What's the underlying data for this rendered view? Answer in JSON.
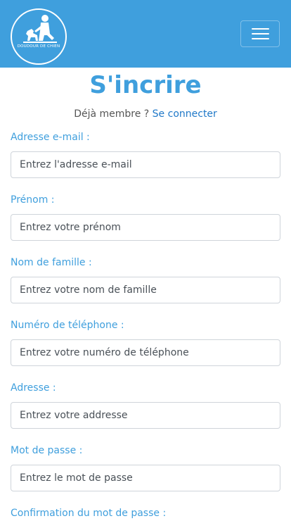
{
  "navbar": {
    "logo_text": "DOUDOUR DE CHIEN",
    "brand_color": "#3f9fdd"
  },
  "page": {
    "title": "S'incrire",
    "member_prompt": "Déjà membre ?",
    "login_link": "Se connecter"
  },
  "form": {
    "fields": [
      {
        "label": "Adresse e-mail :",
        "placeholder": "Entrez l'adresse e-mail"
      },
      {
        "label": "Prénom :",
        "placeholder": "Entrez votre prénom"
      },
      {
        "label": "Nom de famille :",
        "placeholder": "Entrez votre nom de famille"
      },
      {
        "label": "Numéro de téléphone :",
        "placeholder": "Entrez votre numéro de téléphone"
      },
      {
        "label": "Adresse :",
        "placeholder": "Entrez votre addresse"
      },
      {
        "label": "Mot de passe :",
        "placeholder": "Entrez le mot de passe"
      },
      {
        "label": "Confirmation du mot de passe :",
        "placeholder": ""
      }
    ]
  },
  "icons": [
    "logo-icon",
    "menu-icon"
  ]
}
